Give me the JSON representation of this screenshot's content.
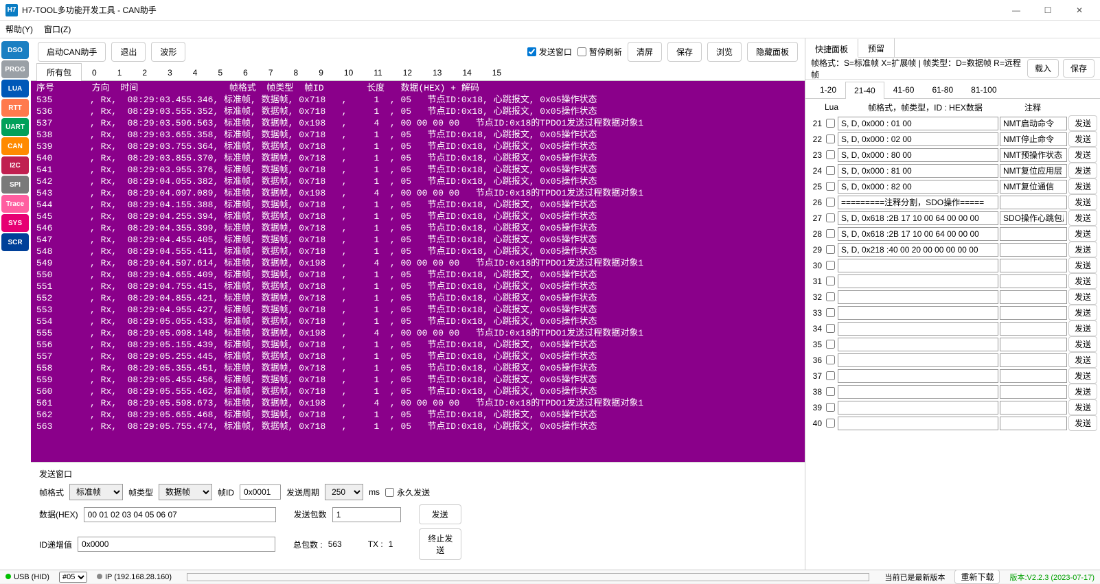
{
  "window": {
    "title": "H7-TOOL多功能开发工具 - CAN助手",
    "icon": "H7"
  },
  "menu": {
    "help": "帮助(Y)",
    "window": "窗口(Z)"
  },
  "sidebar": [
    {
      "label": "DSO",
      "color": "#1a7fc2"
    },
    {
      "label": "PROG",
      "color": "#9aa0a6"
    },
    {
      "label": "LUA",
      "color": "#0058b8"
    },
    {
      "label": "RTT",
      "color": "#ff7a4d"
    },
    {
      "label": "UART",
      "color": "#00a05a"
    },
    {
      "label": "CAN",
      "color": "#ff8a00"
    },
    {
      "label": "I2C",
      "color": "#c02050"
    },
    {
      "label": "SPI",
      "color": "#7a7a7a"
    },
    {
      "label": "Trace",
      "color": "#ff5ea0"
    },
    {
      "label": "SYS",
      "color": "#e60073"
    },
    {
      "label": "SCR",
      "color": "#004099"
    }
  ],
  "toolbar": {
    "start": "启动CAN助手",
    "exit": "退出",
    "wave": "波形",
    "sendwin": "发送窗口",
    "pause": "暂停刷新",
    "clear": "清屏",
    "save": "保存",
    "browse": "浏览",
    "hide": "隐藏面板",
    "sendwin_checked": true,
    "pause_checked": false
  },
  "tabs": {
    "all": "所有包",
    "numbers": [
      "0",
      "1",
      "2",
      "3",
      "4",
      "5",
      "6",
      "7",
      "8",
      "9",
      "10",
      "11",
      "12",
      "13",
      "14",
      "15"
    ]
  },
  "header": "序号       方向  时间                 帧格式  帧类型  帧ID        长度   数据(HEX) + 解码",
  "rows": [
    {
      "n": "535",
      "dir": "Rx",
      "t": "08:29:03.455.346",
      "fmt": "标准帧",
      "tp": "数据帧",
      "id": "0x718",
      "len": "1",
      "d": "05   节点ID:0x18, 心跳报文, 0x05操作状态"
    },
    {
      "n": "536",
      "dir": "Rx",
      "t": "08:29:03.555.352",
      "fmt": "标准帧",
      "tp": "数据帧",
      "id": "0x718",
      "len": "1",
      "d": "05   节点ID:0x18, 心跳报文, 0x05操作状态"
    },
    {
      "n": "537",
      "dir": "Rx",
      "t": "08:29:03.596.563",
      "fmt": "标准帧",
      "tp": "数据帧",
      "id": "0x198",
      "len": "4",
      "d": "00 00 00 00   节点ID:0x18的TPDO1发送过程数据对象1"
    },
    {
      "n": "538",
      "dir": "Rx",
      "t": "08:29:03.655.358",
      "fmt": "标准帧",
      "tp": "数据帧",
      "id": "0x718",
      "len": "1",
      "d": "05   节点ID:0x18, 心跳报文, 0x05操作状态"
    },
    {
      "n": "539",
      "dir": "Rx",
      "t": "08:29:03.755.364",
      "fmt": "标准帧",
      "tp": "数据帧",
      "id": "0x718",
      "len": "1",
      "d": "05   节点ID:0x18, 心跳报文, 0x05操作状态"
    },
    {
      "n": "540",
      "dir": "Rx",
      "t": "08:29:03.855.370",
      "fmt": "标准帧",
      "tp": "数据帧",
      "id": "0x718",
      "len": "1",
      "d": "05   节点ID:0x18, 心跳报文, 0x05操作状态"
    },
    {
      "n": "541",
      "dir": "Rx",
      "t": "08:29:03.955.376",
      "fmt": "标准帧",
      "tp": "数据帧",
      "id": "0x718",
      "len": "1",
      "d": "05   节点ID:0x18, 心跳报文, 0x05操作状态"
    },
    {
      "n": "542",
      "dir": "Rx",
      "t": "08:29:04.055.382",
      "fmt": "标准帧",
      "tp": "数据帧",
      "id": "0x718",
      "len": "1",
      "d": "05   节点ID:0x18, 心跳报文, 0x05操作状态"
    },
    {
      "n": "543",
      "dir": "Rx",
      "t": "08:29:04.097.089",
      "fmt": "标准帧",
      "tp": "数据帧",
      "id": "0x198",
      "len": "4",
      "d": "00 00 00 00   节点ID:0x18的TPDO1发送过程数据对象1"
    },
    {
      "n": "544",
      "dir": "Rx",
      "t": "08:29:04.155.388",
      "fmt": "标准帧",
      "tp": "数据帧",
      "id": "0x718",
      "len": "1",
      "d": "05   节点ID:0x18, 心跳报文, 0x05操作状态"
    },
    {
      "n": "545",
      "dir": "Rx",
      "t": "08:29:04.255.394",
      "fmt": "标准帧",
      "tp": "数据帧",
      "id": "0x718",
      "len": "1",
      "d": "05   节点ID:0x18, 心跳报文, 0x05操作状态"
    },
    {
      "n": "546",
      "dir": "Rx",
      "t": "08:29:04.355.399",
      "fmt": "标准帧",
      "tp": "数据帧",
      "id": "0x718",
      "len": "1",
      "d": "05   节点ID:0x18, 心跳报文, 0x05操作状态"
    },
    {
      "n": "547",
      "dir": "Rx",
      "t": "08:29:04.455.405",
      "fmt": "标准帧",
      "tp": "数据帧",
      "id": "0x718",
      "len": "1",
      "d": "05   节点ID:0x18, 心跳报文, 0x05操作状态"
    },
    {
      "n": "548",
      "dir": "Rx",
      "t": "08:29:04.555.411",
      "fmt": "标准帧",
      "tp": "数据帧",
      "id": "0x718",
      "len": "1",
      "d": "05   节点ID:0x18, 心跳报文, 0x05操作状态"
    },
    {
      "n": "549",
      "dir": "Rx",
      "t": "08:29:04.597.614",
      "fmt": "标准帧",
      "tp": "数据帧",
      "id": "0x198",
      "len": "4",
      "d": "00 00 00 00   节点ID:0x18的TPDO1发送过程数据对象1"
    },
    {
      "n": "550",
      "dir": "Rx",
      "t": "08:29:04.655.409",
      "fmt": "标准帧",
      "tp": "数据帧",
      "id": "0x718",
      "len": "1",
      "d": "05   节点ID:0x18, 心跳报文, 0x05操作状态"
    },
    {
      "n": "551",
      "dir": "Rx",
      "t": "08:29:04.755.415",
      "fmt": "标准帧",
      "tp": "数据帧",
      "id": "0x718",
      "len": "1",
      "d": "05   节点ID:0x18, 心跳报文, 0x05操作状态"
    },
    {
      "n": "552",
      "dir": "Rx",
      "t": "08:29:04.855.421",
      "fmt": "标准帧",
      "tp": "数据帧",
      "id": "0x718",
      "len": "1",
      "d": "05   节点ID:0x18, 心跳报文, 0x05操作状态"
    },
    {
      "n": "553",
      "dir": "Rx",
      "t": "08:29:04.955.427",
      "fmt": "标准帧",
      "tp": "数据帧",
      "id": "0x718",
      "len": "1",
      "d": "05   节点ID:0x18, 心跳报文, 0x05操作状态"
    },
    {
      "n": "554",
      "dir": "Rx",
      "t": "08:29:05.055.433",
      "fmt": "标准帧",
      "tp": "数据帧",
      "id": "0x718",
      "len": "1",
      "d": "05   节点ID:0x18, 心跳报文, 0x05操作状态"
    },
    {
      "n": "555",
      "dir": "Rx",
      "t": "08:29:05.098.148",
      "fmt": "标准帧",
      "tp": "数据帧",
      "id": "0x198",
      "len": "4",
      "d": "00 00 00 00   节点ID:0x18的TPDO1发送过程数据对象1"
    },
    {
      "n": "556",
      "dir": "Rx",
      "t": "08:29:05.155.439",
      "fmt": "标准帧",
      "tp": "数据帧",
      "id": "0x718",
      "len": "1",
      "d": "05   节点ID:0x18, 心跳报文, 0x05操作状态"
    },
    {
      "n": "557",
      "dir": "Rx",
      "t": "08:29:05.255.445",
      "fmt": "标准帧",
      "tp": "数据帧",
      "id": "0x718",
      "len": "1",
      "d": "05   节点ID:0x18, 心跳报文, 0x05操作状态"
    },
    {
      "n": "558",
      "dir": "Rx",
      "t": "08:29:05.355.451",
      "fmt": "标准帧",
      "tp": "数据帧",
      "id": "0x718",
      "len": "1",
      "d": "05   节点ID:0x18, 心跳报文, 0x05操作状态"
    },
    {
      "n": "559",
      "dir": "Rx",
      "t": "08:29:05.455.456",
      "fmt": "标准帧",
      "tp": "数据帧",
      "id": "0x718",
      "len": "1",
      "d": "05   节点ID:0x18, 心跳报文, 0x05操作状态"
    },
    {
      "n": "560",
      "dir": "Rx",
      "t": "08:29:05.555.462",
      "fmt": "标准帧",
      "tp": "数据帧",
      "id": "0x718",
      "len": "1",
      "d": "05   节点ID:0x18, 心跳报文, 0x05操作状态"
    },
    {
      "n": "561",
      "dir": "Rx",
      "t": "08:29:05.598.673",
      "fmt": "标准帧",
      "tp": "数据帧",
      "id": "0x198",
      "len": "4",
      "d": "00 00 00 00   节点ID:0x18的TPDO1发送过程数据对象1"
    },
    {
      "n": "562",
      "dir": "Rx",
      "t": "08:29:05.655.468",
      "fmt": "标准帧",
      "tp": "数据帧",
      "id": "0x718",
      "len": "1",
      "d": "05   节点ID:0x18, 心跳报文, 0x05操作状态"
    },
    {
      "n": "563",
      "dir": "Rx",
      "t": "08:29:05.755.474",
      "fmt": "标准帧",
      "tp": "数据帧",
      "id": "0x718",
      "len": "1",
      "d": "05   节点ID:0x18, 心跳报文, 0x05操作状态"
    }
  ],
  "send": {
    "title": "发送窗口",
    "fmt_label": "帧格式",
    "fmt": "标准帧",
    "type_label": "帧类型",
    "type": "数据帧",
    "id_label": "帧ID",
    "id": "0x0001",
    "period_label": "发送周期",
    "period": "250",
    "ms": "ms",
    "forever": "永久发送",
    "hex_label": "数据(HEX)",
    "hex": "00 01 02 03 04 05 06 07",
    "count_label": "发送包数",
    "count": "1",
    "send_btn": "发送",
    "inc_label": "ID递增值",
    "inc": "0x0000",
    "total_label": "总包数 :",
    "total": "563",
    "tx_label": "TX  :",
    "tx": "1",
    "stop_btn": "终止发送"
  },
  "right": {
    "tabs": {
      "quick": "快捷面板",
      "reserve": "预留"
    },
    "note": "帧格式：S=标准帧 X=扩展帧 | 帧类型：D=数据帧 R=远程帧",
    "load": "载入",
    "save": "保存",
    "pages": [
      "1-20",
      "21-40",
      "41-60",
      "61-80",
      "81-100"
    ],
    "active_page": 1,
    "listhead": {
      "lua": "Lua",
      "fmt": "帧格式，帧类型，ID : HEX数据",
      "note": "注释"
    },
    "items": [
      {
        "num": "21",
        "d": "S, D, 0x000 : 01 00",
        "note": "NMT启动命令"
      },
      {
        "num": "22",
        "d": "S, D, 0x000 : 02 00",
        "note": "NMT停止命令"
      },
      {
        "num": "23",
        "d": "S, D, 0x000 : 80 00",
        "note": "NMT预操作状态"
      },
      {
        "num": "24",
        "d": "S, D, 0x000 : 81 00",
        "note": "NMT复位应用层"
      },
      {
        "num": "25",
        "d": "S, D, 0x000 : 82 00",
        "note": "NMT复位通信"
      },
      {
        "num": "26",
        "d": "=========注释分割，SDO操作=====",
        "note": ""
      },
      {
        "num": "27",
        "d": "S, D, 0x618 :2B 17 10 00 64 00 00 00",
        "note": "SDO操作心跳包周期"
      },
      {
        "num": "28",
        "d": "S, D, 0x618 :2B 17 10 00 64 00 00 00",
        "note": ""
      },
      {
        "num": "29",
        "d": "S, D, 0x218 :40 00 20 00 00 00 00 00",
        "note": ""
      },
      {
        "num": "30",
        "d": "",
        "note": ""
      },
      {
        "num": "31",
        "d": "",
        "note": ""
      },
      {
        "num": "32",
        "d": "",
        "note": ""
      },
      {
        "num": "33",
        "d": "",
        "note": ""
      },
      {
        "num": "34",
        "d": "",
        "note": ""
      },
      {
        "num": "35",
        "d": "",
        "note": ""
      },
      {
        "num": "36",
        "d": "",
        "note": ""
      },
      {
        "num": "37",
        "d": "",
        "note": ""
      },
      {
        "num": "38",
        "d": "",
        "note": ""
      },
      {
        "num": "39",
        "d": "",
        "note": ""
      },
      {
        "num": "40",
        "d": "",
        "note": ""
      }
    ],
    "send": "发送"
  },
  "status": {
    "usb": "USB (HID)",
    "sel": "#05",
    "ip": "IP (192.168.28.160)",
    "latest": "当前已是最新版本",
    "redown": "重新下载",
    "ver": "版本:V2.2.3 (2023-07-17)"
  }
}
